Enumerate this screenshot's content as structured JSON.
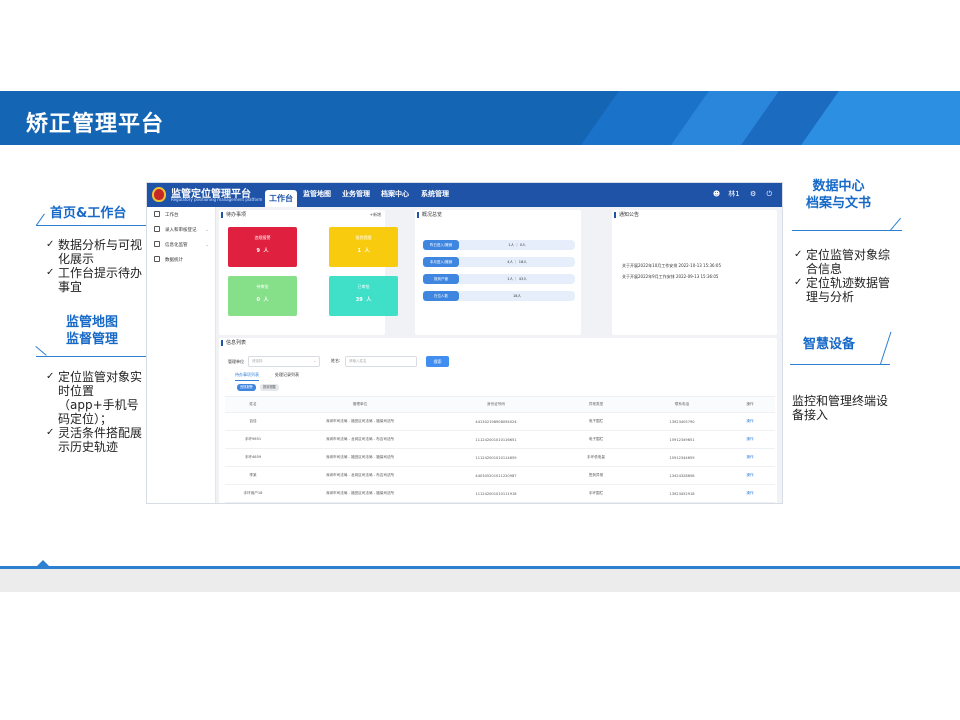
{
  "slide": {
    "title": "矫正管理平台"
  },
  "annotations": {
    "home": {
      "title": "首页&工作台",
      "bullets": [
        "数据分析与可视化展示",
        "工作台提示待办事宜"
      ]
    },
    "map": {
      "title_line1": "监管地图",
      "title_line2": "监督管理",
      "bullets": [
        "定位监管对象实时位置（app+手机号码定位）；",
        "灵活条件搭配展示历史轨迹"
      ]
    },
    "data_center": {
      "title_line1": "数据中心",
      "title_line2": "档案与文书",
      "bullets": [
        "定位监管对象综合信息",
        "定位轨迹数据管理与分析"
      ]
    },
    "devices": {
      "title": "智慧设备",
      "text": "监控和管理终端设备接入"
    }
  },
  "app": {
    "name": "监管定位管理平台",
    "subtitle": "Regulatory positioning management platform",
    "nav": [
      {
        "label": "工作台",
        "active": true
      },
      {
        "label": "监管地图"
      },
      {
        "label": "业务管理"
      },
      {
        "label": "档案中心"
      },
      {
        "label": "系统管理"
      }
    ],
    "user": "林1",
    "sidebar": [
      {
        "label": "工作台"
      },
      {
        "label": "录入和审核登记",
        "has_arrow": true
      },
      {
        "label": "信息化监管",
        "has_arrow": true
      },
      {
        "label": "数据统计"
      }
    ],
    "todo": {
      "title": "待办事项",
      "add": "+新增",
      "cards": [
        {
          "label": "违规报警",
          "value": "9",
          "unit": "人",
          "color": "#e0203f"
        },
        {
          "label": "报到提醒",
          "value": "1",
          "unit": "人",
          "color": "#f8cb0f"
        },
        {
          "label": "待审批",
          "value": "0",
          "unit": "人",
          "color": "#86e08a"
        },
        {
          "label": "已审批",
          "value": "39",
          "unit": "人",
          "color": "#3fdfc8"
        }
      ]
    },
    "overview": {
      "title": "概况总览",
      "rows": [
        {
          "tag": "昨日进入/撤销",
          "text": "1人 ｜ 0人"
        },
        {
          "tag": "本月进入/撤销",
          "text": "4人 ｜ 18人"
        },
        {
          "tag": "报到户管",
          "text": "1人 ｜ 43人"
        },
        {
          "tag": "在位人数",
          "text": "18人"
        }
      ]
    },
    "notices": {
      "title": "通知公告",
      "items": [
        "关于开展2022年10月工作安排 2022-10-13 15:36:05",
        "关于开展2022年9月工作安排 2022-09-13 15:36:05"
      ]
    },
    "info": {
      "title": "信息列表",
      "unit_label": "管理单位",
      "unit_placeholder": "请选择",
      "name_label": "姓名:",
      "name_placeholder": "请输入姓名",
      "search": "搜索",
      "tabs": [
        "待办事项列表",
        "处理记录列表"
      ],
      "chips": [
        "违规报警",
        "报到提醒"
      ],
      "columns": [
        "姓名",
        "管理单位",
        "身份证号码",
        "异常类型",
        "联系电话",
        "操作"
      ],
      "rows": [
        [
          "百佳",
          "深圳市司法局 - 福田区司法局 - 福保司法所",
          "441302198908094024",
          "电子围栏",
          "13923405790",
          "操作"
        ],
        [
          "手环9651",
          "深圳市司法局 - 龙岗区司法局 - 布吉司法所",
          "111242001010116651",
          "电子围栏",
          "15912349651",
          "操作"
        ],
        [
          "手环4659",
          "深圳市司法局 - 福田区司法局 - 福保司法所",
          "111242001010114659",
          "手环低电量",
          "15912344659",
          "操作"
        ],
        [
          "李某",
          "深圳市司法局 - 龙岗区司法局 - 布吉司法所",
          "440305201011220987",
          "签到异常",
          "13424328658",
          "操作"
        ],
        [
          "手环用户18",
          "深圳市司法局 - 福田区司法局 - 福保司法所",
          "111242001010111918",
          "手环围栏",
          "13923452918",
          "操作"
        ]
      ]
    }
  }
}
